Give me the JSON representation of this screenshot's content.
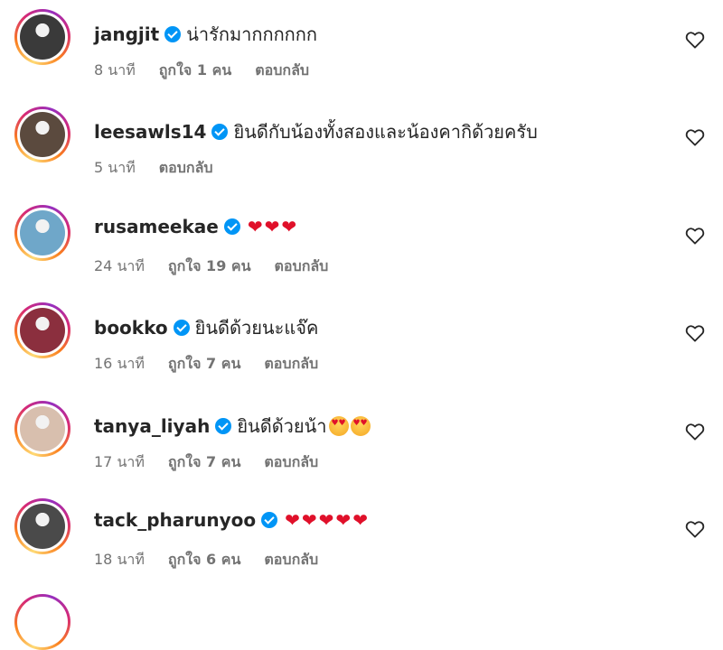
{
  "comments": [
    {
      "username": "jangjit",
      "text": "น่ารักมากกกกกก",
      "emojis": [],
      "time": "8 นาที",
      "likes": "ถูกใจ 1 คน",
      "reply": "ตอบกลับ",
      "avatar_color": "#3a3a3a"
    },
    {
      "username": "leesawls14",
      "text": "ยินดีกับน้องทั้งสองและน้องคากิด้วยครับ",
      "emojis": [],
      "time": "5 นาที",
      "likes": "",
      "reply": "ตอบกลับ",
      "avatar_color": "#5b4a3e"
    },
    {
      "username": "rusameekae",
      "text": "",
      "emojis": [
        "heart",
        "heart",
        "heart"
      ],
      "time": "24 นาที",
      "likes": "ถูกใจ 19 คน",
      "reply": "ตอบกลับ",
      "avatar_color": "#6fa7c9"
    },
    {
      "username": "bookko",
      "text": "ยินดีด้วยนะแจ๊ค",
      "emojis": [],
      "time": "16 นาที",
      "likes": "ถูกใจ 7 คน",
      "reply": "ตอบกลับ",
      "avatar_color": "#8b2f3e"
    },
    {
      "username": "tanya_liyah",
      "text": "ยินดีด้วยน้า",
      "emojis": [
        "heart-eyes",
        "heart-eyes"
      ],
      "time": "17 นาที",
      "likes": "ถูกใจ 7 คน",
      "reply": "ตอบกลับ",
      "avatar_color": "#d8bfae"
    },
    {
      "username": "tack_pharunyoo",
      "text": "",
      "emojis": [
        "heart",
        "heart",
        "heart",
        "heart",
        "heart"
      ],
      "time": "18 นาที",
      "likes": "ถูกใจ 6 คน",
      "reply": "ตอบกลับ",
      "avatar_color": "#4a4a4a"
    }
  ],
  "icons": {
    "like": "heart-outline-icon",
    "verified": "verified-badge-icon"
  },
  "colors": {
    "verified": "#0095f6",
    "meta_text": "#737373",
    "heart": "#e0102a"
  }
}
